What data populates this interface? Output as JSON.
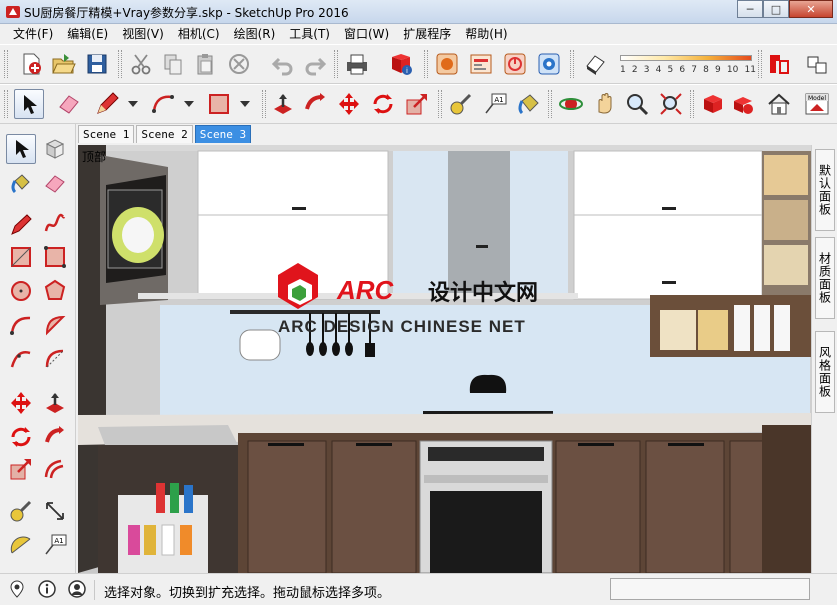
{
  "window": {
    "title": "SU厨房餐厅精模+Vray参数分享.skp - SketchUp Pro 2016",
    "minimize_glyph": "─",
    "maximize_glyph": "□",
    "close_glyph": "✕"
  },
  "menu": [
    "文件(F)",
    "编辑(E)",
    "视图(V)",
    "相机(C)",
    "绘图(R)",
    "工具(T)",
    "窗口(W)",
    "扩展程序",
    "帮助(H)"
  ],
  "toolbar1": {
    "icons": [
      "new-file-icon",
      "open-folder-icon",
      "save-icon",
      "cut-icon",
      "copy-icon",
      "paste-icon",
      "erase-icon",
      "undo-icon",
      "redo-icon",
      "print-icon",
      "model-info-icon",
      "render-settings-icon",
      "frame-buffer-icon",
      "interactive-render-icon",
      "vray-settings-icon",
      "eraser-style-icon",
      "layers-icon",
      "collapse-icon"
    ],
    "scale_numbers": [
      "1",
      "2",
      "3",
      "4",
      "5",
      "6",
      "7",
      "8",
      "9",
      "10",
      "11"
    ]
  },
  "toolbar2": {
    "icons": [
      "select-icon",
      "eraser-icon",
      "pencil-icon",
      "arc-icon",
      "rectangle-icon",
      "push-pull-icon",
      "follow-me-icon",
      "move-icon",
      "rotate-icon",
      "scale-icon",
      "tape-measure-icon",
      "text-icon",
      "paint-bucket-icon",
      "orbit-icon",
      "pan-icon",
      "zoom-icon",
      "zoom-extents-icon",
      "3d-warehouse-icon",
      "extension-warehouse-icon",
      "house-icon",
      "model-icon"
    ],
    "text_tool_label": "A1",
    "model_label": "Model"
  },
  "palette": {
    "icons": [
      "select-icon",
      "component-icon",
      "paint-icon",
      "eraser-icon",
      "line-icon",
      "freehand-icon",
      "rectangle-icon",
      "rotated-rectangle-icon",
      "circle-icon",
      "polygon-icon",
      "arc-icon",
      "pie-icon",
      "arc-3pt-icon",
      "arc-2pt-icon",
      "move-icon",
      "push-pull-icon",
      "rotate-icon",
      "follow-me-icon",
      "scale-icon",
      "offset-icon",
      "tape-measure-icon",
      "dimension-icon",
      "protractor-icon",
      "text-icon"
    ],
    "text_tool_label": "A1"
  },
  "scenes": [
    "Scene 1",
    "Scene 2",
    "Scene 3"
  ],
  "active_scene": "Scene 3",
  "viewport": {
    "corner_label": "顶部",
    "watermark_logo": "ARC",
    "watermark_cn": "设计中文网",
    "watermark_en": "ARC DESIGN CHINESE NET"
  },
  "trays": [
    "默认面板",
    "材质面板",
    "风格面板"
  ],
  "status": {
    "message": "选择对象。切换到扩充选择。拖动鼠标选择多项。",
    "icons": [
      "geo-location-icon",
      "info-icon",
      "user-icon"
    ]
  },
  "colors": {
    "accent_tab": "#3c8fe3",
    "brand_red": "#e0141c",
    "wood": "#5d4536",
    "cabinet_white": "#ffffff",
    "backsplash": "#d7e6f3"
  }
}
